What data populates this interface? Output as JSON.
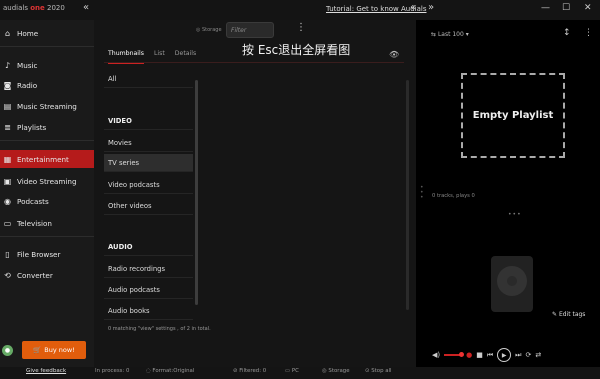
{
  "app": {
    "logo_text": "audials",
    "logo_accent": "one",
    "logo_year": "2020",
    "tutorial_link": "Tutorial: Get to know Audials"
  },
  "overlay_text": "按 Esc退出全屏看图",
  "sidebar": {
    "items": [
      {
        "label": "Home",
        "icon": "home-icon"
      },
      {
        "label": "Music",
        "icon": "music-note-icon"
      },
      {
        "label": "Radio",
        "icon": "radio-icon"
      },
      {
        "label": "Music Streaming",
        "icon": "streaming-icon"
      },
      {
        "label": "Playlists",
        "icon": "playlist-icon"
      },
      {
        "label": "Entertainment",
        "icon": "entertainment-icon"
      },
      {
        "label": "Video Streaming",
        "icon": "video-stream-icon"
      },
      {
        "label": "Podcasts",
        "icon": "podcast-icon"
      },
      {
        "label": "Television",
        "icon": "tv-icon"
      },
      {
        "label": "File Browser",
        "icon": "file-icon"
      },
      {
        "label": "Converter",
        "icon": "converter-icon"
      }
    ],
    "active": "Entertainment",
    "buy_now": "Buy now!",
    "give_feedback": "Give feedback"
  },
  "main": {
    "storage_label": "Storage",
    "filter_placeholder": "Filter",
    "tabs": [
      "Thumbnails",
      "List",
      "Details"
    ],
    "selected_tab": "Thumbnails",
    "categories": [
      {
        "label": "All",
        "head": false
      },
      {
        "label": "VIDEO",
        "head": true
      },
      {
        "label": "Movies",
        "head": false
      },
      {
        "label": "TV series",
        "head": false,
        "selected": true
      },
      {
        "label": "Video podcasts",
        "head": false
      },
      {
        "label": "Other videos",
        "head": false
      },
      {
        "label": "AUDIO",
        "head": true
      },
      {
        "label": "Radio recordings",
        "head": false
      },
      {
        "label": "Audio podcasts",
        "head": false
      },
      {
        "label": "Audio books",
        "head": false
      }
    ],
    "matching_text": "0 matching \"view\" settings , of 2 in total."
  },
  "right": {
    "playlist_selector": "Last 100",
    "empty_playlist": "Empty Playlist",
    "tracks_info": "0 tracks, plays 0",
    "edit_tags": "Edit tags"
  },
  "statusbar": {
    "in_process": "In process: 0",
    "format": "Format:Original",
    "filtered": "Filtered: 0",
    "pc": "PC",
    "storage": "Storage",
    "stop_all": "Stop all"
  },
  "colors": {
    "accent": "#b51b1b",
    "buy_button": "#e15d0c"
  }
}
